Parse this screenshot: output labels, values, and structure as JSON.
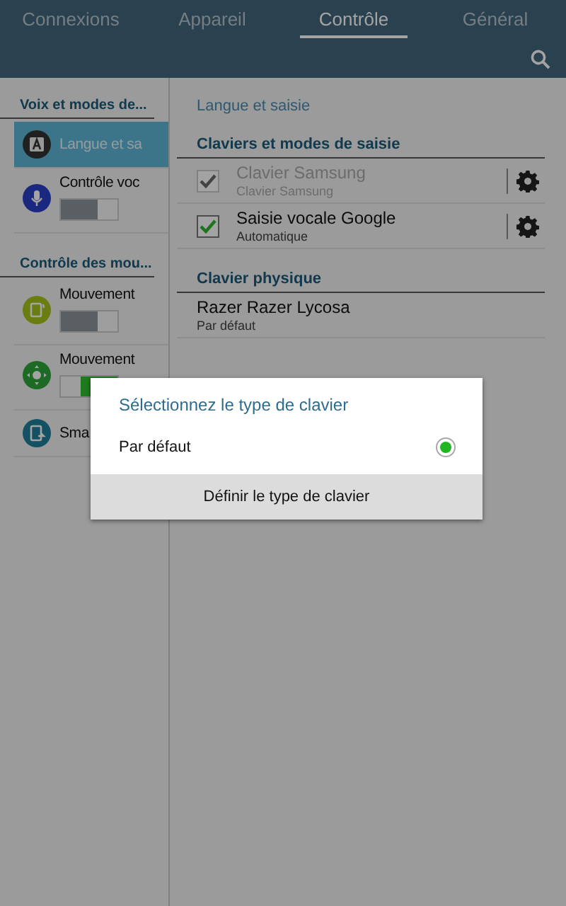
{
  "tabs": [
    {
      "label": "Connexions",
      "selected": false
    },
    {
      "label": "Appareil",
      "selected": false
    },
    {
      "label": "Contrôle",
      "selected": true
    },
    {
      "label": "Général",
      "selected": false
    }
  ],
  "sidebar": {
    "sections": [
      {
        "title": "Voix et modes de...",
        "items": [
          {
            "label": "Langue et sa",
            "kind": "keyboard",
            "selected": true
          },
          {
            "label": "Contrôle voc",
            "kind": "mic",
            "selected": false,
            "toggle": {
              "on": false
            }
          }
        ]
      },
      {
        "title": "Contrôle des mou...",
        "items": [
          {
            "label": "Mouvement",
            "kind": "motion",
            "selected": false,
            "toggle": {
              "on": false
            }
          },
          {
            "label": "Mouvement",
            "kind": "palm",
            "selected": false,
            "toggle": {
              "on": true
            }
          },
          {
            "label": "Sma",
            "kind": "screen",
            "selected": false
          }
        ]
      }
    ]
  },
  "content": {
    "title": "Langue et saisie",
    "sections": [
      {
        "title": "Claviers et modes de saisie",
        "rows": [
          {
            "kind": "checkbox",
            "title": "Clavier Samsung",
            "subtitle": "Clavier Samsung",
            "checked": true,
            "disabled": true
          },
          {
            "kind": "checkbox",
            "title": "Saisie vocale Google",
            "subtitle": "Automatique",
            "checked": true,
            "disabled": false
          }
        ]
      },
      {
        "title": "Clavier physique",
        "rows": [
          {
            "kind": "plain",
            "title": "Razer Razer Lycosa",
            "subtitle": "Par défaut"
          }
        ]
      }
    ]
  },
  "dialog": {
    "title": "Sélectionnez le type de clavier",
    "options": [
      {
        "label": "Par défaut",
        "selected": true
      }
    ],
    "button": "Définir le type de clavier"
  }
}
